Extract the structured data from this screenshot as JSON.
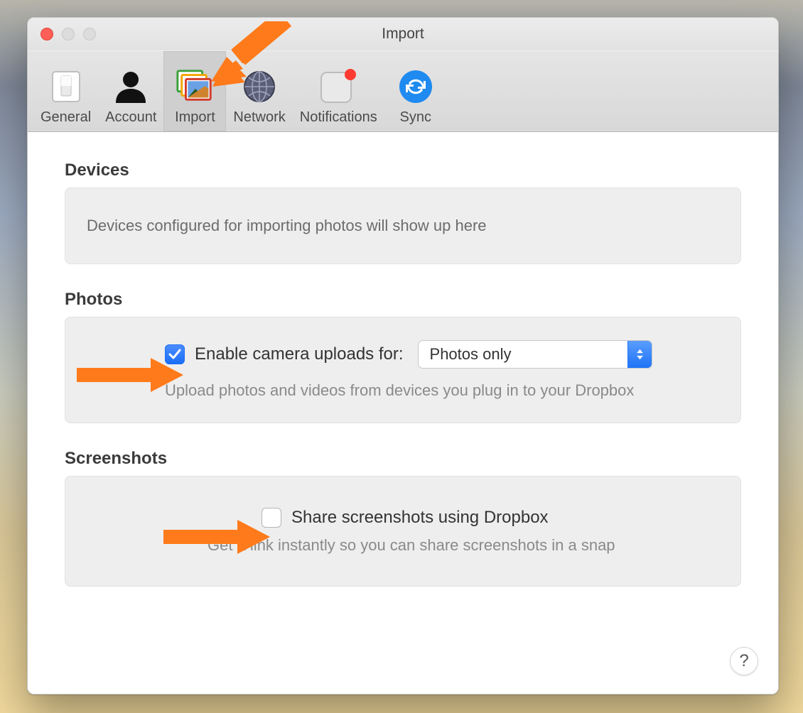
{
  "window": {
    "title": "Import"
  },
  "toolbar": {
    "items": [
      {
        "label": "General"
      },
      {
        "label": "Account"
      },
      {
        "label": "Import"
      },
      {
        "label": "Network"
      },
      {
        "label": "Notifications"
      },
      {
        "label": "Sync"
      }
    ],
    "active_index": 2
  },
  "sections": {
    "devices": {
      "title": "Devices",
      "placeholder": "Devices configured for importing photos will show up here"
    },
    "photos": {
      "title": "Photos",
      "checkbox_label": "Enable camera uploads for:",
      "checkbox_checked": true,
      "select_value": "Photos only",
      "help": "Upload photos and videos from devices you plug in to your Dropbox"
    },
    "screenshots": {
      "title": "Screenshots",
      "checkbox_label": "Share screenshots using Dropbox",
      "checkbox_checked": false,
      "help": "Get a link instantly so you can share screenshots in a snap"
    }
  },
  "help_button": "?"
}
